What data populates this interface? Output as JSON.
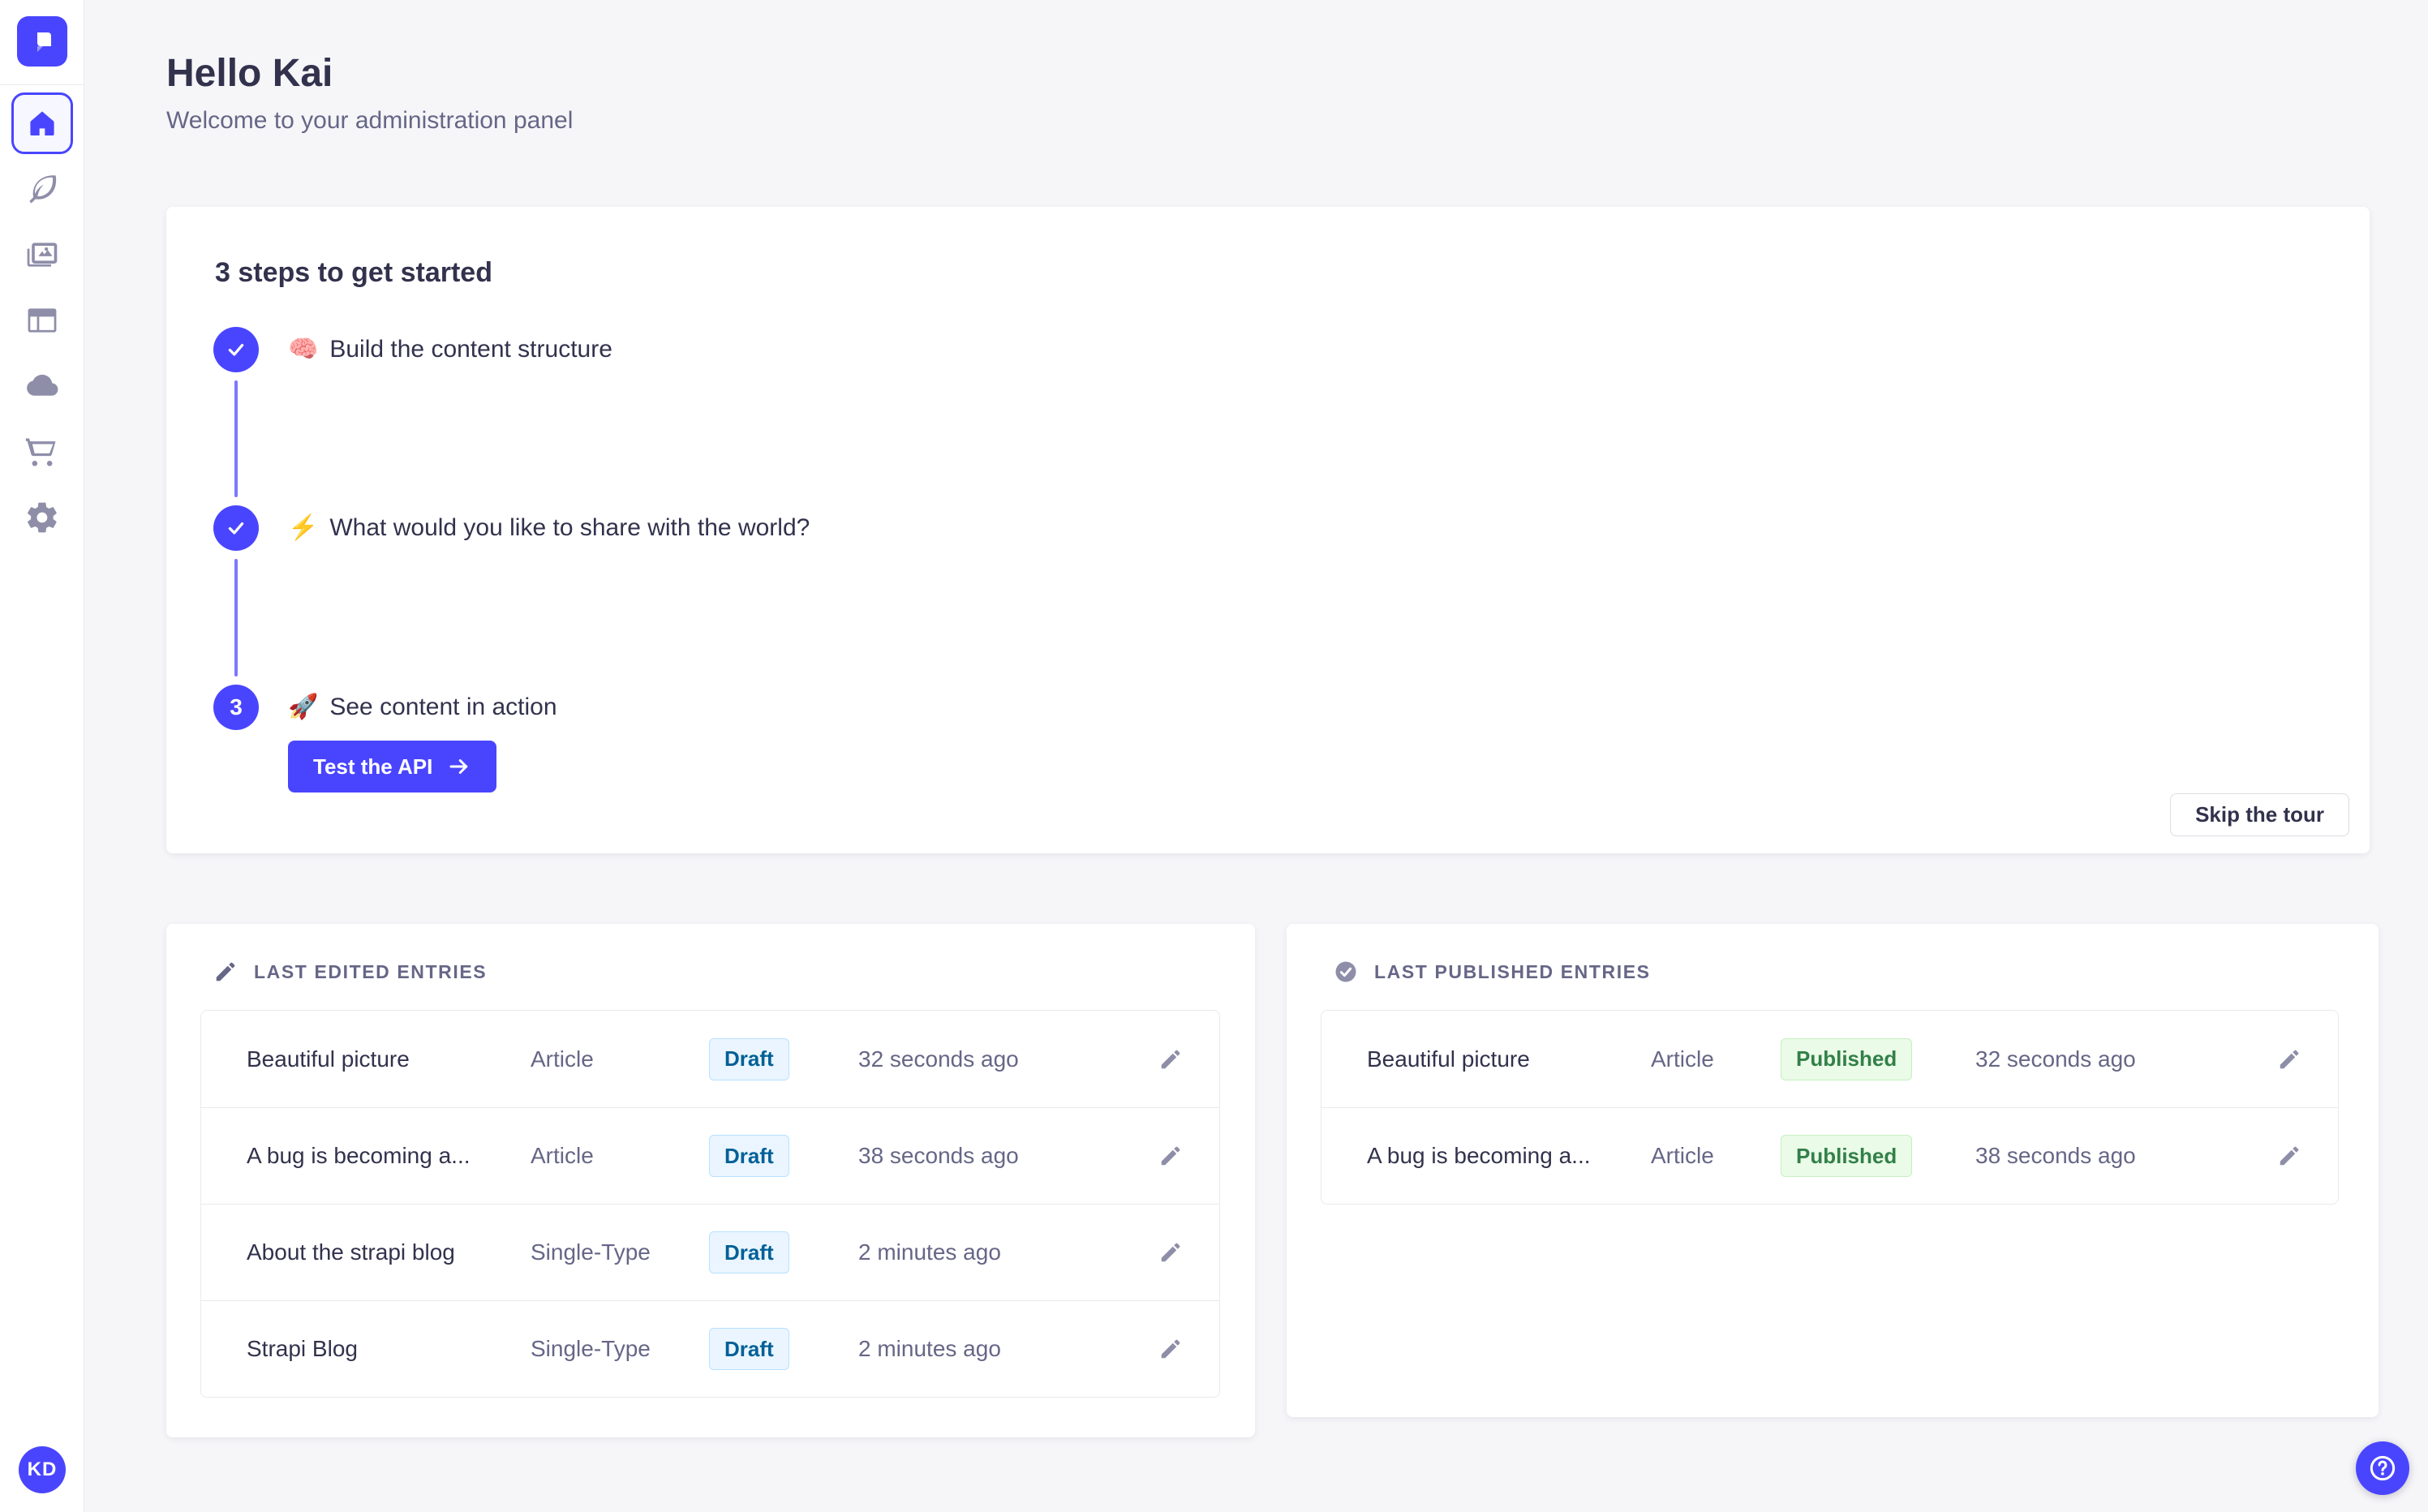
{
  "sidebar": {
    "logo_icon": "strapi-logo-icon",
    "items": [
      {
        "id": "home",
        "icon": "home-icon",
        "active": true
      },
      {
        "id": "content-manager",
        "icon": "feather-icon",
        "active": false
      },
      {
        "id": "media-library",
        "icon": "pictures-icon",
        "active": false
      },
      {
        "id": "content-type-builder",
        "icon": "layout-icon",
        "active": false
      },
      {
        "id": "cloud",
        "icon": "cloud-icon",
        "active": false
      },
      {
        "id": "marketplace",
        "icon": "cart-icon",
        "active": false
      },
      {
        "id": "settings",
        "icon": "gear-icon",
        "active": false
      }
    ],
    "avatar_initials": "KD"
  },
  "header": {
    "title": "Hello Kai",
    "subtitle": "Welcome to your administration panel"
  },
  "onboarding": {
    "title": "3 steps to get started",
    "steps": [
      {
        "state": "done",
        "emoji": "🧠",
        "label": "Build the content structure"
      },
      {
        "state": "done",
        "emoji": "⚡",
        "label": "What would you like to share with the world?"
      },
      {
        "state": "current",
        "number_label": "3",
        "emoji": "🚀",
        "label": "See content in action"
      }
    ],
    "cta_label": "Test the API",
    "skip_label": "Skip the tour"
  },
  "panels": {
    "edited": {
      "title": "LAST EDITED ENTRIES",
      "icon": "pencil-icon",
      "rows": [
        {
          "name": "Beautiful picture",
          "type": "Article",
          "status": "Draft",
          "time": "32 seconds ago"
        },
        {
          "name": "A bug is becoming a...",
          "type": "Article",
          "status": "Draft",
          "time": "38 seconds ago"
        },
        {
          "name": "About the strapi blog",
          "type": "Single-Type",
          "status": "Draft",
          "time": "2 minutes ago"
        },
        {
          "name": "Strapi Blog",
          "type": "Single-Type",
          "status": "Draft",
          "time": "2 minutes ago"
        }
      ]
    },
    "published": {
      "title": "LAST PUBLISHED ENTRIES",
      "icon": "check-circle-icon",
      "rows": [
        {
          "name": "Beautiful picture",
          "type": "Article",
          "status": "Published",
          "time": "32 seconds ago"
        },
        {
          "name": "A bug is becoming a...",
          "type": "Article",
          "status": "Published",
          "time": "38 seconds ago"
        }
      ]
    }
  },
  "help": {
    "icon": "question-mark-icon"
  },
  "colors": {
    "primary": "#4945FF",
    "connector": "#7B79FF",
    "background": "#F6F6F9",
    "heading": "#32324D",
    "muted": "#666687",
    "icon_gray": "#8E8EA9",
    "border": "#EAEAEF",
    "draft_bg": "#EAF5FF",
    "draft_border": "#B8E1FF",
    "draft_text": "#006096",
    "published_bg": "#EAFBE7",
    "published_border": "#C6F0C2",
    "published_text": "#328048"
  }
}
